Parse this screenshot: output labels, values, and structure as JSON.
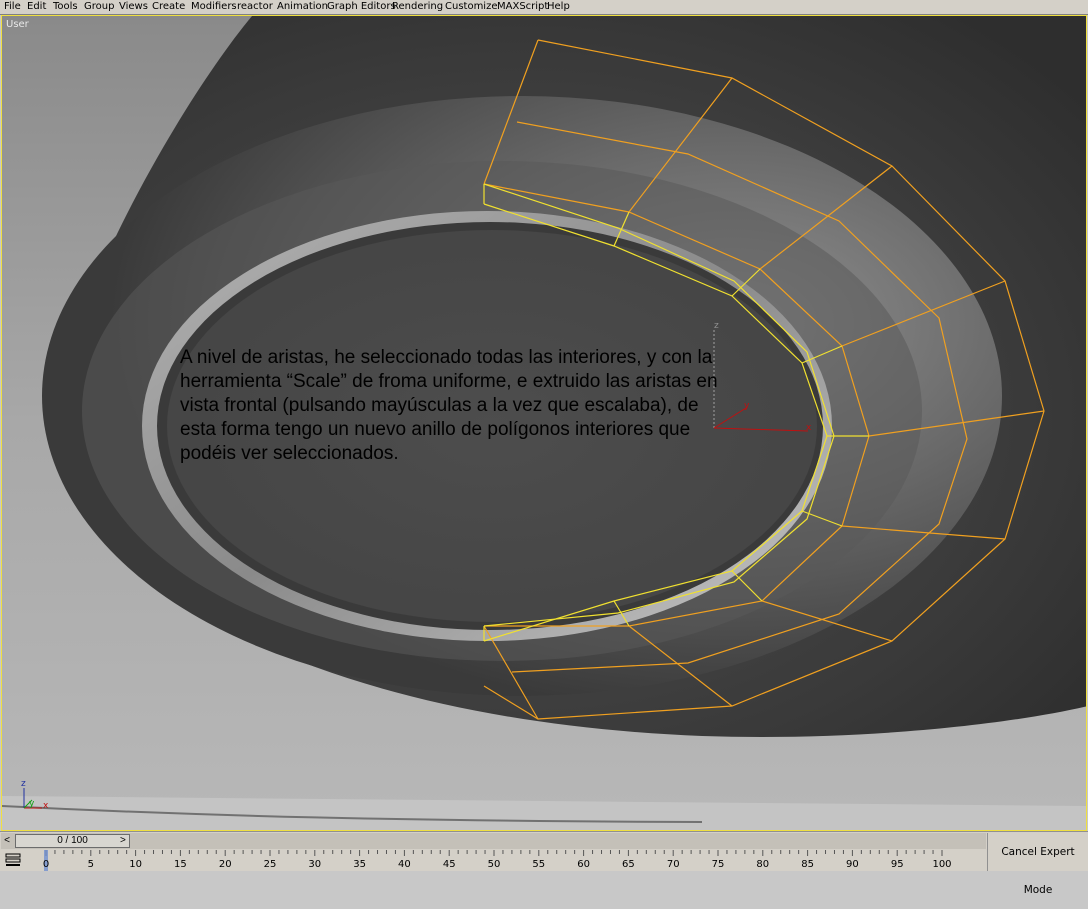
{
  "menu": {
    "items": [
      "File",
      "Edit",
      "Tools",
      "Group",
      "Views",
      "Create",
      "Modifiers",
      "reactor",
      "Animation",
      "Graph Editors",
      "Rendering",
      "Customize",
      "MAXScript",
      "Help"
    ]
  },
  "viewport": {
    "label": "User",
    "note": "A nivel de aristas, he seleccionado todas las interiores, y con la herramienta “Scale” de froma uniforme, e extruido las aristas en vista frontal (pulsando mayúsculas a la vez que escalaba), de esta forma tengo un nuevo anillo de polígonos interiores que podéis ver seleccionados.",
    "gizmo_axes": {
      "x": "x",
      "y": "y",
      "z": "z"
    },
    "corner_axes": {
      "x": "x",
      "y": "y",
      "z": "z"
    },
    "colors": {
      "selection_edges": "#f0a020",
      "inner_edges": "#f0e030",
      "border": "#f0e040",
      "x_axis": "#c01010",
      "y_axis": "#10a010"
    }
  },
  "timeline": {
    "slider_text": "0 / 100",
    "prev_arrow": "<",
    "next_arrow": ">",
    "tick_labels": [
      "0",
      "5",
      "10",
      "15",
      "20",
      "25",
      "30",
      "35",
      "40",
      "45",
      "50",
      "55",
      "60",
      "65",
      "70",
      "75",
      "80",
      "85",
      "90",
      "95",
      "100"
    ],
    "current_frame": 0
  },
  "status": {
    "cancel_expert_label": "Cancel Expert Mode"
  },
  "icons": {
    "trackbar_toggle": "trackbar-icon"
  }
}
